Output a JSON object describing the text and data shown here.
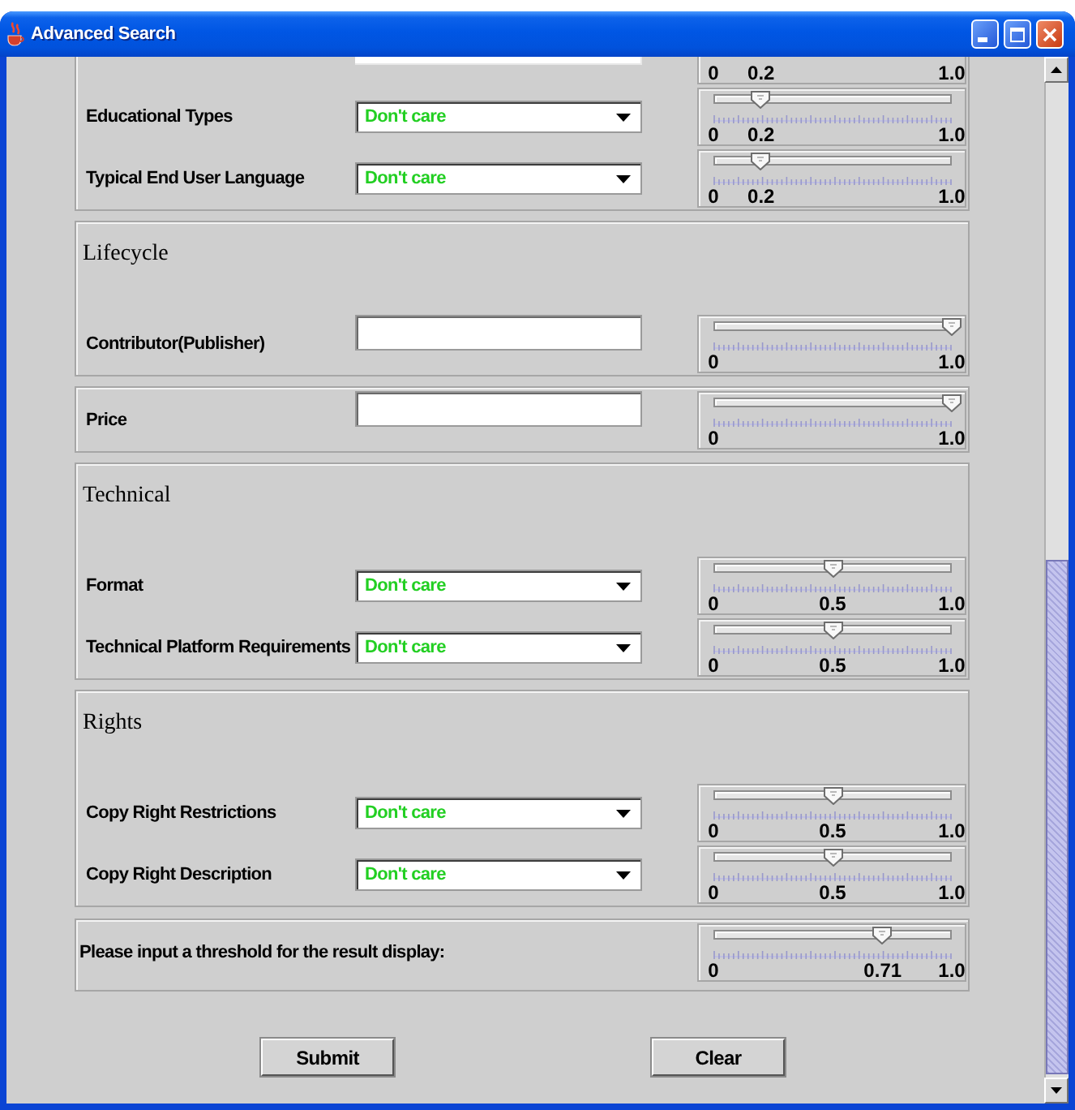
{
  "window": {
    "title": "Advanced Search"
  },
  "sections": [
    {
      "rows": [
        {
          "kind": "partial",
          "slider": {
            "level": 0.2,
            "min_label": "0",
            "value_label": "0.2",
            "max_label": "1.0"
          }
        },
        {
          "kind": "dropdown",
          "label": "Educational Types",
          "value": "Don't care",
          "slider": {
            "level": 0.2,
            "min_label": "0",
            "value_label": "0.2",
            "max_label": "1.0"
          }
        },
        {
          "kind": "dropdown",
          "label": "Typical End User Language",
          "value": "Don't care",
          "slider": {
            "level": 0.2,
            "min_label": "0",
            "value_label": "0.2",
            "max_label": "1.0"
          }
        }
      ]
    },
    {
      "title": "Lifecycle",
      "rows": [
        {
          "kind": "text",
          "label": "Contributor(Publisher)",
          "slider": {
            "level": 1,
            "min_label": "0",
            "max_label": "1.0"
          }
        }
      ]
    },
    {
      "rows": [
        {
          "kind": "text",
          "label": "Price",
          "slider": {
            "level": 1,
            "min_label": "0",
            "max_label": "1.0"
          }
        }
      ]
    },
    {
      "title": "Technical",
      "rows": [
        {
          "kind": "dropdown",
          "label": "Format",
          "value": "Don't care",
          "slider": {
            "level": 0.5,
            "min_label": "0",
            "value_label": "0.5",
            "max_label": "1.0"
          }
        },
        {
          "kind": "dropdown",
          "label": "Technical Platform Requirements",
          "value": "Don't care",
          "slider": {
            "level": 0.5,
            "min_label": "0",
            "value_label": "0.5",
            "max_label": "1.0"
          }
        }
      ]
    },
    {
      "title": "Rights",
      "rows": [
        {
          "kind": "dropdown",
          "label": "Copy Right Restrictions",
          "value": "Don't care",
          "slider": {
            "level": 0.5,
            "min_label": "0",
            "value_label": "0.5",
            "max_label": "1.0"
          }
        },
        {
          "kind": "dropdown",
          "label": "Copy Right Description",
          "value": "Don't care",
          "slider": {
            "level": 0.5,
            "min_label": "0",
            "value_label": "0.5",
            "max_label": "1.0"
          }
        }
      ]
    }
  ],
  "threshold": {
    "label": "Please input a threshold for the result display:",
    "slider": {
      "level": 0.71,
      "min_label": "0",
      "value_label": "0.71",
      "max_label": "1.0"
    }
  },
  "buttons": [
    "Submit",
    "Clear"
  ]
}
